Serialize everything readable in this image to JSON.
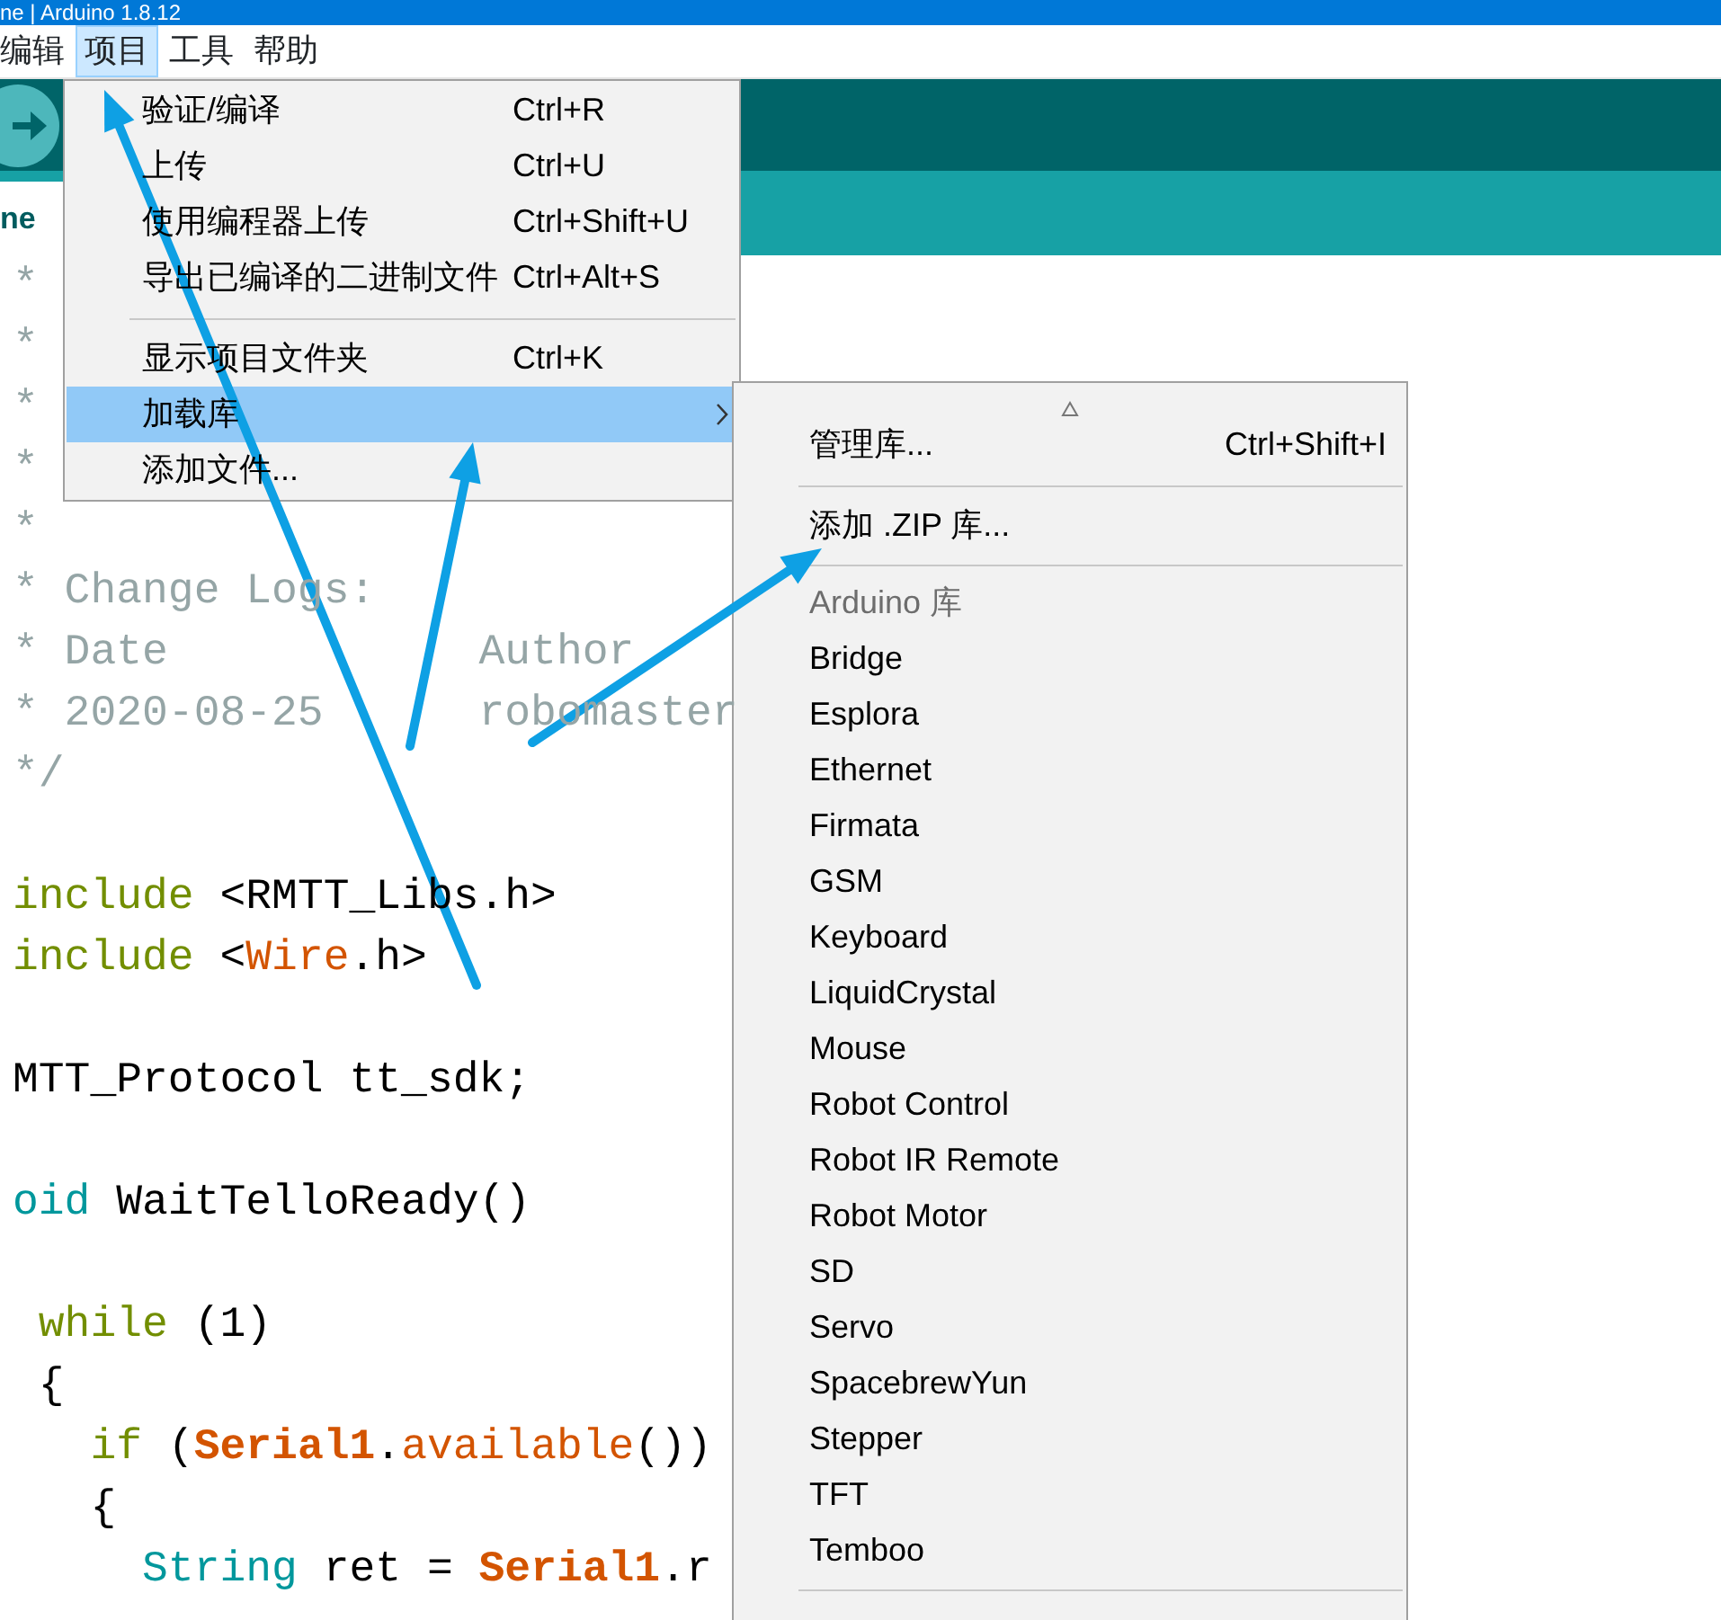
{
  "window": {
    "title": "ne | Arduino 1.8.12"
  },
  "menubar": [
    {
      "label": "编辑",
      "selected": false
    },
    {
      "label": "项目",
      "selected": true
    },
    {
      "label": "工具",
      "selected": false
    },
    {
      "label": "帮助",
      "selected": false
    }
  ],
  "tab": {
    "label": "ne"
  },
  "code_lines": [
    [
      {
        "kind": "comment",
        "text": "*"
      }
    ],
    [
      {
        "kind": "comment",
        "text": "*"
      }
    ],
    [
      {
        "kind": "comment",
        "text": "*"
      }
    ],
    [
      {
        "kind": "comment",
        "text": "*"
      }
    ],
    [
      {
        "kind": "comment",
        "text": "*"
      }
    ],
    [
      {
        "kind": "comment",
        "text": "* Change Logs:"
      }
    ],
    [
      {
        "kind": "comment",
        "text": "* Date            Author"
      }
    ],
    [
      {
        "kind": "comment",
        "text": "* 2020-08-25      robomaster"
      }
    ],
    [
      {
        "kind": "comment",
        "text": "*/"
      }
    ],
    [
      {
        "kind": "gap"
      },
      {
        "kind": "keyword",
        "text": "include"
      },
      {
        "kind": "plain",
        "text": " <RMTT_Libs.h>"
      }
    ],
    [
      {
        "kind": "keyword",
        "text": "include"
      },
      {
        "kind": "plain",
        "text": " <"
      },
      {
        "kind": "func",
        "text": "Wire"
      },
      {
        "kind": "plain",
        "text": ".h>"
      }
    ],
    [
      {
        "kind": "gap"
      },
      {
        "kind": "plain",
        "text": "MTT_Protocol tt_sdk;"
      }
    ],
    [
      {
        "kind": "gap"
      },
      {
        "kind": "type",
        "text": "oid"
      },
      {
        "kind": "plain",
        "text": " WaitTelloReady()"
      }
    ],
    [
      {
        "kind": "gap"
      },
      {
        "kind": "keyword",
        "text": " while"
      },
      {
        "kind": "plain",
        "text": " (1)"
      }
    ],
    [
      {
        "kind": "plain",
        "text": " {"
      }
    ],
    [
      {
        "kind": "keyword",
        "text": "   if"
      },
      {
        "kind": "plain",
        "text": " ("
      },
      {
        "kind": "class",
        "text": "Serial1"
      },
      {
        "kind": "plain",
        "text": "."
      },
      {
        "kind": "func",
        "text": "available"
      },
      {
        "kind": "plain",
        "text": "())"
      }
    ],
    [
      {
        "kind": "plain",
        "text": "   {"
      }
    ],
    [
      {
        "kind": "type",
        "text": "     String"
      },
      {
        "kind": "plain",
        "text": " ret = "
      },
      {
        "kind": "class",
        "text": "Serial1"
      },
      {
        "kind": "plain",
        "text": ".r"
      }
    ]
  ],
  "project_menu": [
    {
      "kind": "item",
      "label": "验证/编译",
      "shortcut": "Ctrl+R",
      "highlighted": false,
      "submenu": false
    },
    {
      "kind": "item",
      "label": "上传",
      "shortcut": "Ctrl+U",
      "highlighted": false,
      "submenu": false
    },
    {
      "kind": "item",
      "label": "使用编程器上传",
      "shortcut": "Ctrl+Shift+U",
      "highlighted": false,
      "submenu": false
    },
    {
      "kind": "item",
      "label": "导出已编译的二进制文件",
      "shortcut": "Ctrl+Alt+S",
      "highlighted": false,
      "submenu": false
    },
    {
      "kind": "separator"
    },
    {
      "kind": "item",
      "label": "显示项目文件夹",
      "shortcut": "Ctrl+K",
      "highlighted": false,
      "submenu": false
    },
    {
      "kind": "item",
      "label": "加载库",
      "highlighted": true,
      "submenu": true
    },
    {
      "kind": "item",
      "label": "添加文件...",
      "highlighted": false,
      "submenu": false
    }
  ],
  "library_menu": [
    {
      "kind": "scroll"
    },
    {
      "kind": "item",
      "label": "管理库...",
      "shortcut": "Ctrl+Shift+I",
      "disabled": false
    },
    {
      "kind": "separator"
    },
    {
      "kind": "item",
      "label": "添加 .ZIP 库...",
      "disabled": false
    },
    {
      "kind": "separator"
    },
    {
      "kind": "item",
      "label": "Arduino 库",
      "disabled": true
    },
    {
      "kind": "item",
      "label": "Bridge",
      "disabled": false
    },
    {
      "kind": "item",
      "label": "Esplora",
      "disabled": false
    },
    {
      "kind": "item",
      "label": "Ethernet",
      "disabled": false
    },
    {
      "kind": "item",
      "label": "Firmata",
      "disabled": false
    },
    {
      "kind": "item",
      "label": "GSM",
      "disabled": false
    },
    {
      "kind": "item",
      "label": "Keyboard",
      "disabled": false
    },
    {
      "kind": "item",
      "label": "LiquidCrystal",
      "disabled": false
    },
    {
      "kind": "item",
      "label": "Mouse",
      "disabled": false
    },
    {
      "kind": "item",
      "label": "Robot Control",
      "disabled": false
    },
    {
      "kind": "item",
      "label": "Robot IR Remote",
      "disabled": false
    },
    {
      "kind": "item",
      "label": "Robot Motor",
      "disabled": false
    },
    {
      "kind": "item",
      "label": "SD",
      "disabled": false
    },
    {
      "kind": "item",
      "label": "Servo",
      "disabled": false
    },
    {
      "kind": "item",
      "label": "SpacebrewYun",
      "disabled": false
    },
    {
      "kind": "item",
      "label": "Stepper",
      "disabled": false
    },
    {
      "kind": "item",
      "label": "TFT",
      "disabled": false
    },
    {
      "kind": "item",
      "label": "Temboo",
      "disabled": false
    },
    {
      "kind": "separator"
    }
  ]
}
